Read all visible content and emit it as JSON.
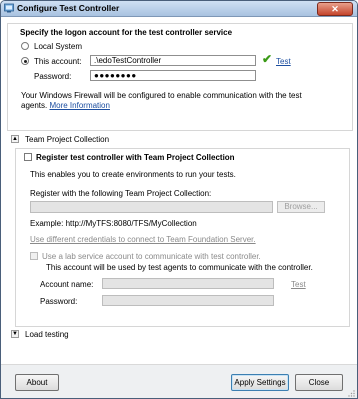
{
  "window": {
    "title": "Configure Test Controller"
  },
  "logon": {
    "section_title": "Specify the logon account for the test controller service",
    "local_system_label": "Local System",
    "this_account_label": "This account:",
    "account_value": ".\\edoTestController",
    "test_link": "Test",
    "password_label": "Password:",
    "password_value": "●●●●●●●●",
    "firewall_note_1": "Your Windows Firewall will be configured to enable communication with the test",
    "firewall_note_2": "agents.",
    "more_info_link": "More Information"
  },
  "tpc": {
    "expander_label": "Team Project Collection",
    "register_label": "Register test controller with Team Project Collection",
    "enable_note": "This enables you to create environments to run your tests.",
    "register_with_label": "Register with the following Team Project Collection:",
    "collection_value": "",
    "browse_label": "Browse...",
    "example_text": "Example: http://MyTFS:8080/TFS/MyCollection",
    "diff_credentials_link": "Use different credentials to connect to Team Foundation Server.",
    "lab_service_label": "Use a lab service account to communicate with test controller.",
    "lab_note": "This account will be used by test agents to communicate with the controller.",
    "account_name_label": "Account name:",
    "account_name_value": "",
    "test_link": "Test",
    "password_label": "Password:",
    "password_value": ""
  },
  "load": {
    "expander_label": "Load testing"
  },
  "footer": {
    "about_label": "About",
    "apply_label": "Apply Settings",
    "close_label": "Close"
  }
}
